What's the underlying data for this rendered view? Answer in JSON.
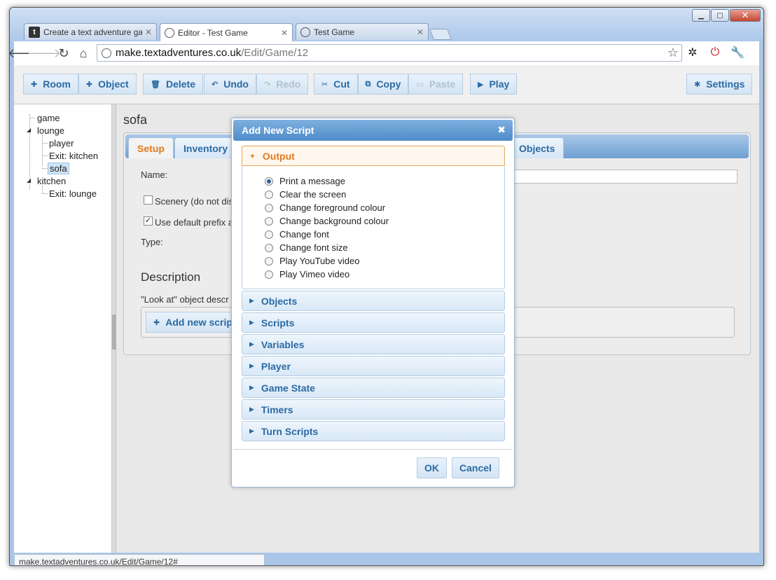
{
  "browser": {
    "tabs": [
      {
        "title": "Create a text adventure gam",
        "icon": "t-favicon"
      },
      {
        "title": "Editor - Test Game",
        "icon": "globe-icon"
      },
      {
        "title": "Test Game",
        "icon": "globe-icon"
      }
    ],
    "url_host": "make.textadventures.co.uk",
    "url_path": "/Edit/Game/12",
    "status_url": "make.textadventures.co.uk/Edit/Game/12#"
  },
  "toolbar": {
    "room": "Room",
    "object": "Object",
    "delete": "Delete",
    "undo": "Undo",
    "redo": "Redo",
    "cut": "Cut",
    "copy": "Copy",
    "paste": "Paste",
    "play": "Play",
    "settings": "Settings"
  },
  "tree": {
    "game": "game",
    "lounge": "lounge",
    "player": "player",
    "exit_kitchen": "Exit: kitchen",
    "sofa": "sofa",
    "kitchen": "kitchen",
    "exit_lounge": "Exit: lounge"
  },
  "editor": {
    "title": "sofa",
    "tabs": {
      "setup": "Setup",
      "inventory": "Inventory",
      "objects": "Objects"
    },
    "name_label": "Name:",
    "scenery_label": "Scenery (do not dis",
    "prefix_label": "Use default prefix a",
    "type_label": "Type:",
    "description_title": "Description",
    "look_at_label": "\"Look at\" object descr",
    "add_script": "Add new script"
  },
  "dialog": {
    "title": "Add New Script",
    "close": "✖",
    "sections": {
      "output": "Output",
      "objects": "Objects",
      "scripts": "Scripts",
      "variables": "Variables",
      "player": "Player",
      "game_state": "Game State",
      "timers": "Timers",
      "turn_scripts": "Turn Scripts"
    },
    "options": [
      "Print a message",
      "Clear the screen",
      "Change foreground colour",
      "Change background colour",
      "Change font",
      "Change font size",
      "Play YouTube video",
      "Play Vimeo video"
    ],
    "selected_option": "Print a message",
    "ok": "OK",
    "cancel": "Cancel"
  },
  "colors": {
    "accent_blue": "#2b6aa3",
    "accent_orange": "#e07a1e",
    "title_bar": "#4e8bc8"
  }
}
